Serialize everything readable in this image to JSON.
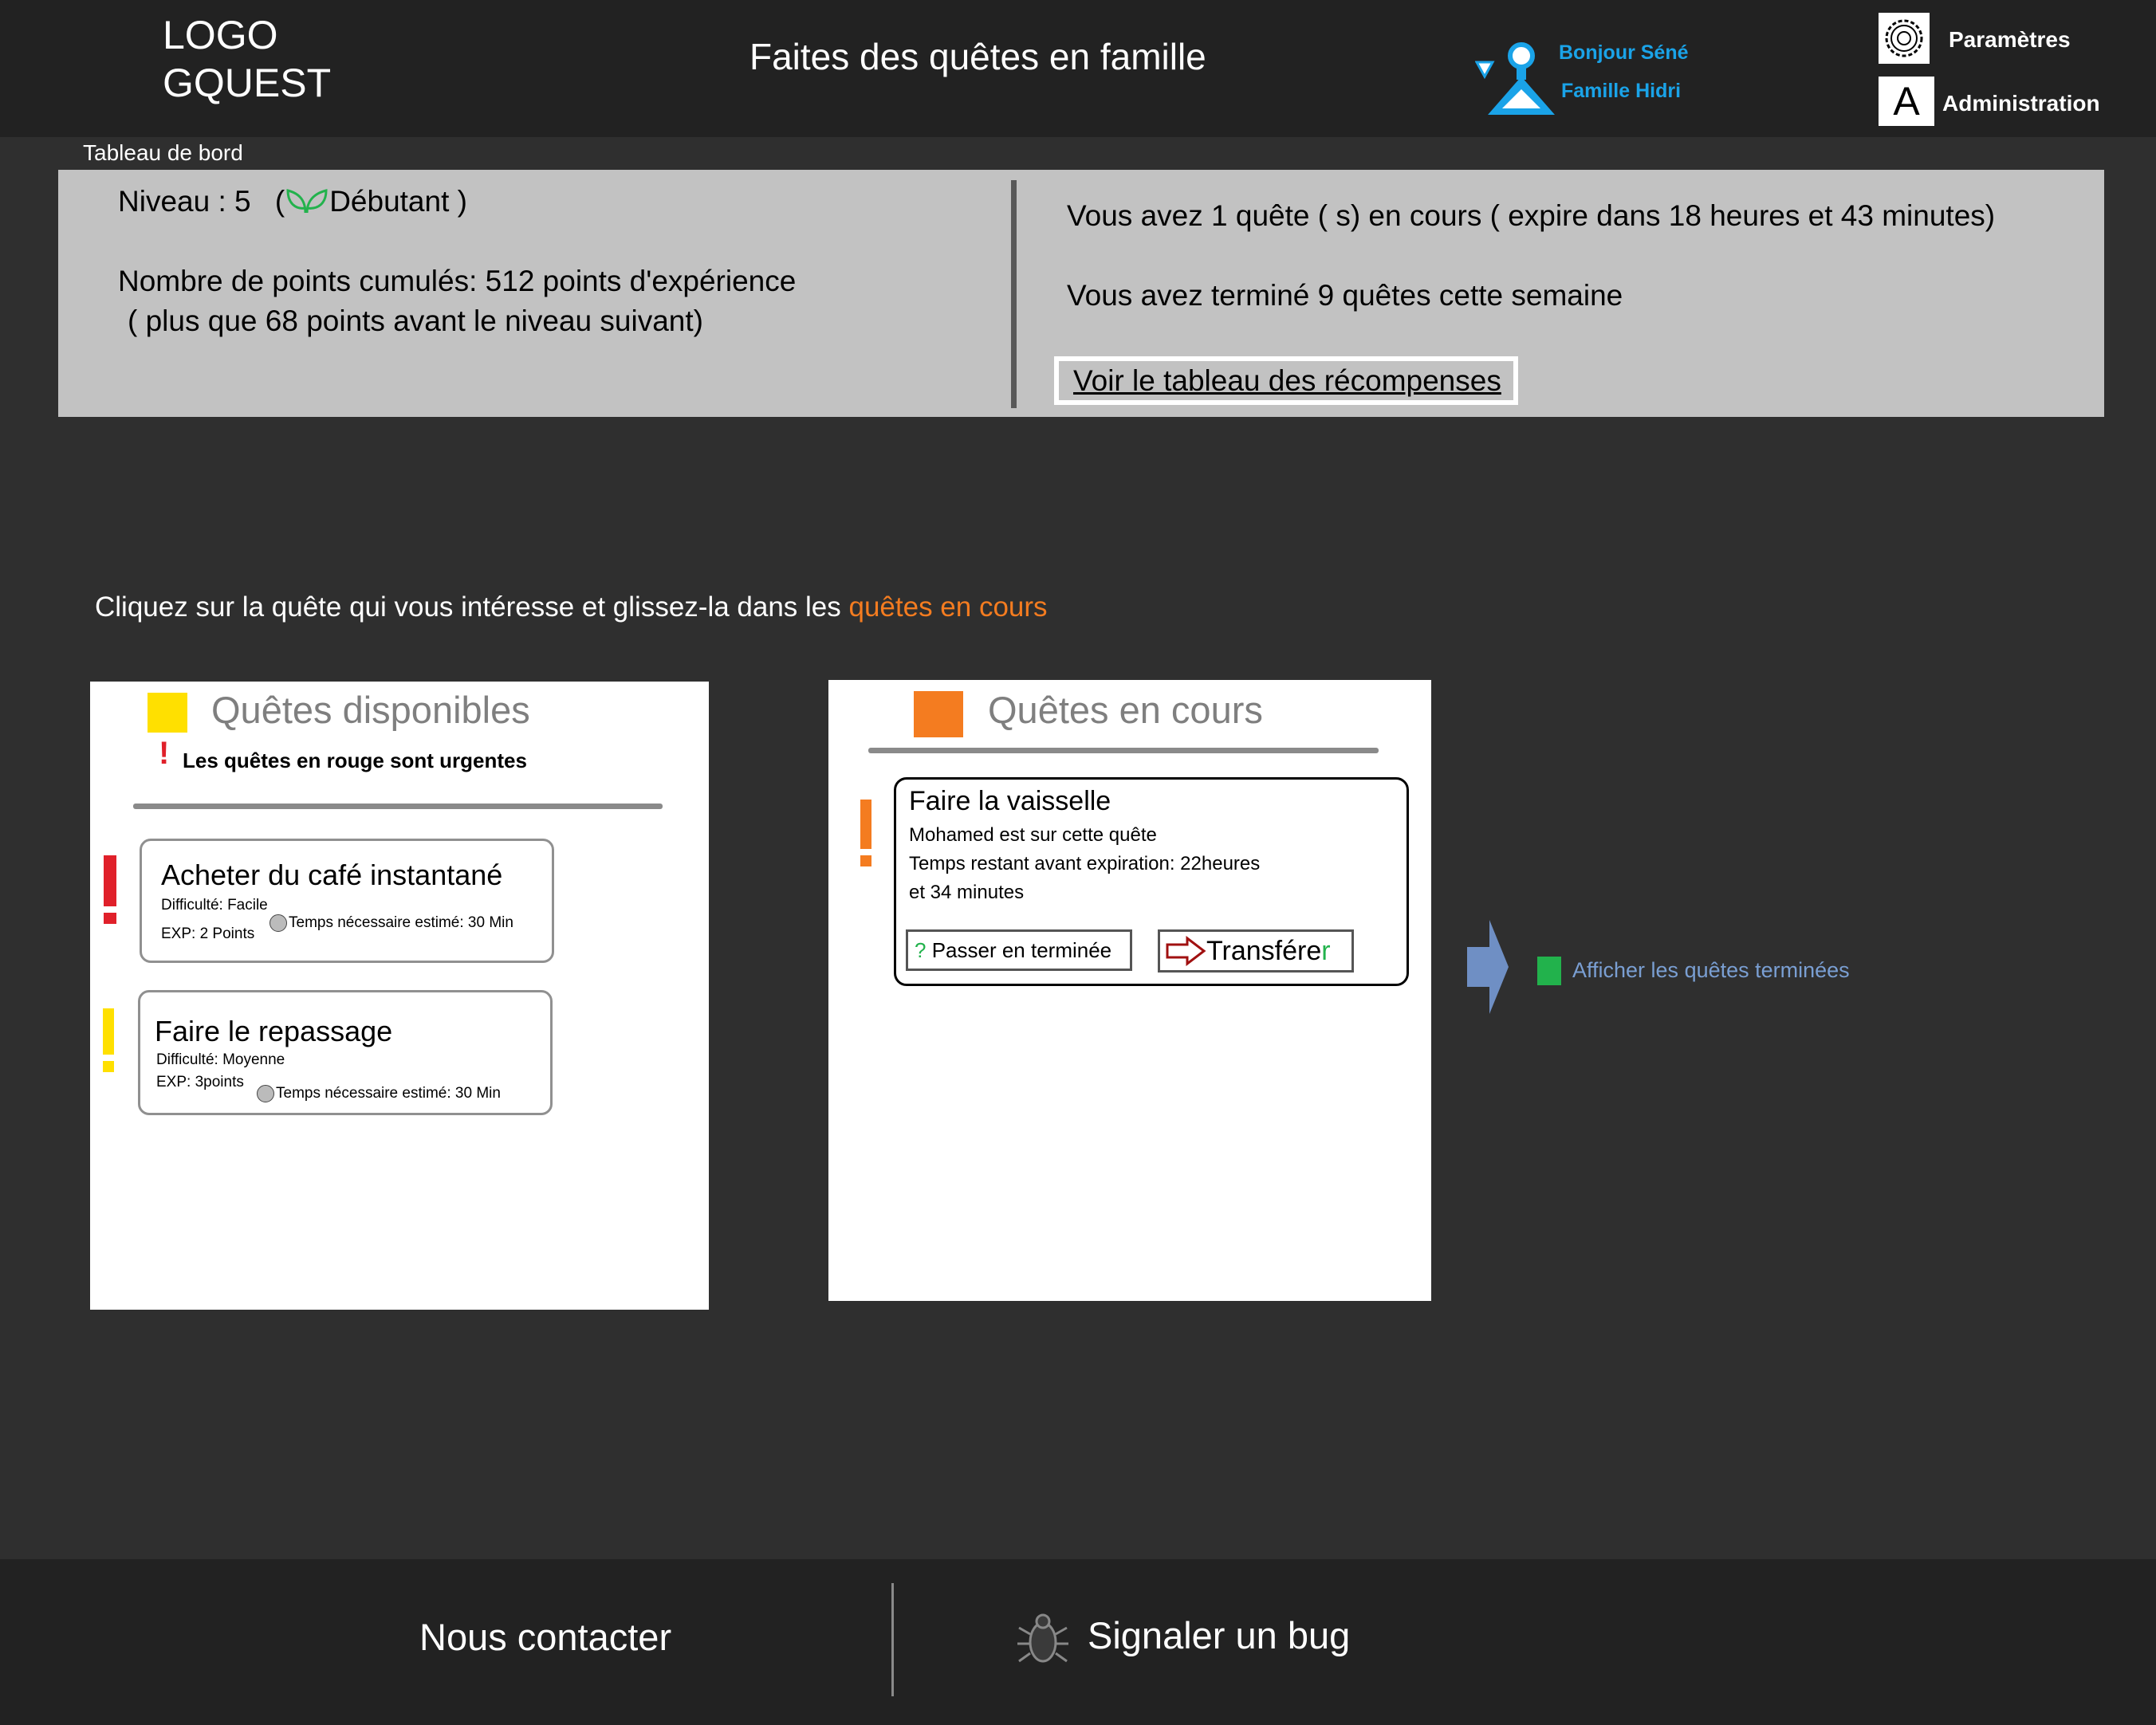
{
  "header": {
    "logo_line1": "LOGO",
    "logo_line2": "GQUEST",
    "tagline": "Faites des quêtes en famille",
    "greeting": "Bonjour Séné",
    "family": "Famille Hidri",
    "settings_label": "Paramètres",
    "admin_icon_letter": "A",
    "admin_label": "Administration"
  },
  "breadcrumb": "Tableau de bord",
  "dashboard": {
    "level_prefix": "Niveau : 5",
    "level_paren_open": "(",
    "level_rank": "Débutant",
    "level_paren_close": ")",
    "points_line": "Nombre de points cumulés: 512 points d'expérience",
    "points_sub": "( plus que  68 points avant le niveau suivant)",
    "active_quests": "Vous avez 1 quête  ( s)    en cours   ( expire dans  18 heures et  43 minutes)",
    "done_week": "Vous avez terminé 9 quêtes cette semaine",
    "rewards_link": "Voir le tableau des récompenses"
  },
  "instruction": {
    "text": "Cliquez sur la quête qui vous intéresse et glissez-la dans les ",
    "highlight": "quêtes en cours"
  },
  "available": {
    "title": "Quêtes disponibles",
    "urgent_note": "Les quêtes en rouge sont urgentes",
    "quests": [
      {
        "title": "Acheter du café instantané",
        "difficulty": "Difficulté: Facile",
        "exp": "EXP: 2 Points",
        "time": "Temps nécessaire estimé: 30 Min"
      },
      {
        "title": "Faire le repassage",
        "difficulty": "Difficulté: Moyenne",
        "exp": "EXP: 3points",
        "time": "Temps nécessaire estimé: 30 Min"
      }
    ]
  },
  "current": {
    "title": "Quêtes en cours",
    "quest": {
      "title": "Faire la vaisselle",
      "assignee": "Mohamed est sur cette quête",
      "remaining_line1": "Temps restant avant expiration: 22heures",
      "remaining_line2": "et 34 minutes",
      "complete_btn_mark": "?",
      "complete_btn": "Passer en terminée",
      "transfer_btn": "Transfére",
      "transfer_btn_last": "r"
    }
  },
  "show_completed": "Afficher les quêtes terminées",
  "footer": {
    "contact": "Nous contacter",
    "bug": "Signaler un bug"
  },
  "colors": {
    "header_bg": "#222222",
    "page_bg": "#2f2f2f",
    "dashboard_bg": "#c2c2c2",
    "accent_blue": "#1aa3e8",
    "accent_orange": "#f47c20",
    "urgent_red": "#e0202a",
    "medium_yellow": "#ffe000",
    "green": "#22b24c",
    "link_blue": "#7a9fd3"
  }
}
